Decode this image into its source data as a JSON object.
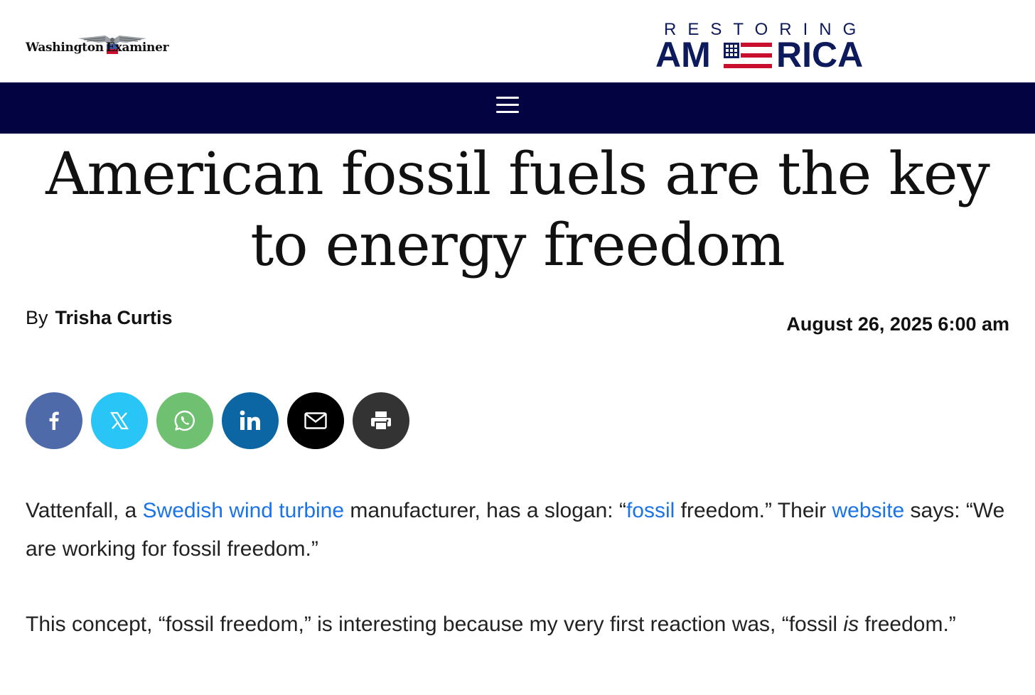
{
  "header": {
    "left_logo_text_left": "Washington",
    "left_logo_text_right": "Examiner",
    "right_logo_top": "RESTORING",
    "right_logo_bottom_left": "AM",
    "right_logo_bottom_right": "RICA",
    "nav_color": "#030341",
    "menu_icon": "hamburger-icon"
  },
  "article": {
    "title": "American fossil fuels are the key to energy freedom",
    "byline_prefix": "By",
    "author": "Trisha Curtis",
    "date": "August 26, 2025 6:00 am"
  },
  "share": [
    {
      "network": "facebook",
      "icon": "facebook-icon",
      "color": "#4e6aa9"
    },
    {
      "network": "x",
      "icon": "x-icon",
      "color": "#29c5f6"
    },
    {
      "network": "whatsapp",
      "icon": "whatsapp-icon",
      "color": "#6fc171"
    },
    {
      "network": "linkedin",
      "icon": "linkedin-icon",
      "color": "#0c66a3"
    },
    {
      "network": "email",
      "icon": "email-icon",
      "color": "#000000"
    },
    {
      "network": "print",
      "icon": "print-icon",
      "color": "#333333"
    }
  ],
  "body": {
    "p1": {
      "t1": "Vattenfall, a ",
      "link1": "Swedish wind turbine",
      "t2": " manufacturer, has a slogan: “",
      "link2": "fossil",
      "t3": " freedom.” Their ",
      "link3": "website",
      "t4": " says: “We are working for fossil freedom.”"
    },
    "p2": {
      "t1": "This concept, “fossil freedom,” is interesting because my very first reaction was, “fossil ",
      "em": "is",
      "t2": " freedom.”"
    },
    "link_color": "#1a73e8"
  }
}
